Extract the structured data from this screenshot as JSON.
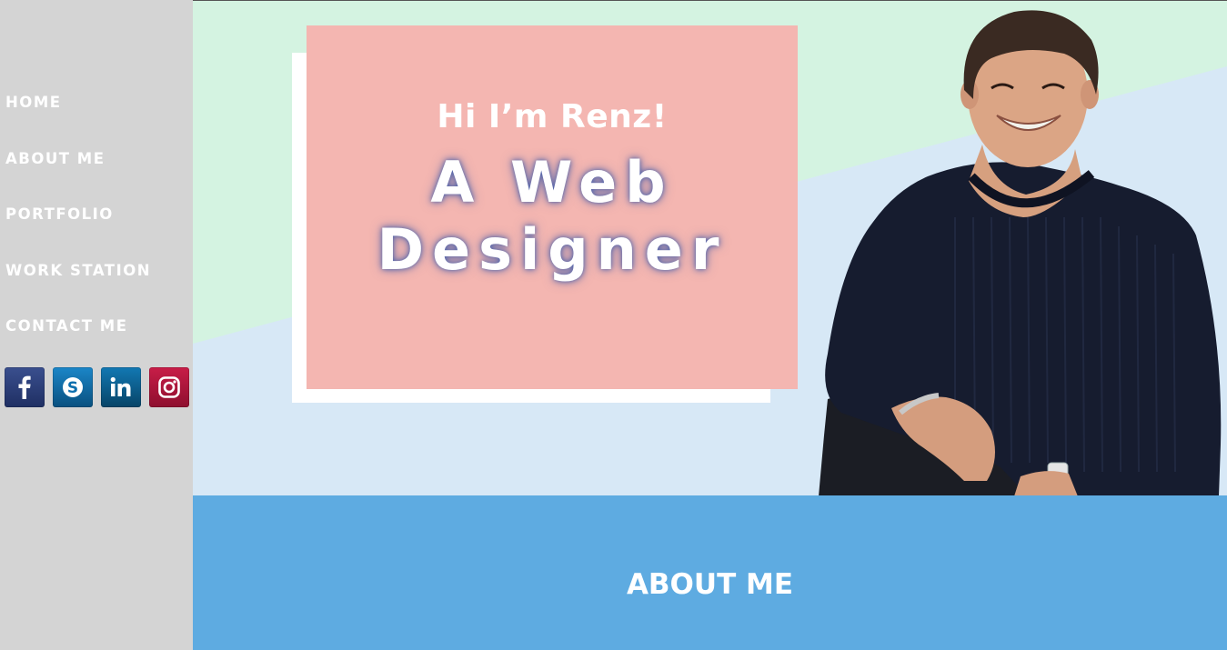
{
  "sidebar": {
    "nav": [
      {
        "label": "HOME"
      },
      {
        "label": "ABOUT ME"
      },
      {
        "label": "PORTFOLIO"
      },
      {
        "label": "WORK STATION"
      },
      {
        "label": "CONTACT ME"
      }
    ],
    "social": [
      {
        "icon": "facebook-icon",
        "glyph": "f",
        "color": "#2b3f7a"
      },
      {
        "icon": "skype-icon",
        "glyph": "S",
        "color": "#0d6fae"
      },
      {
        "icon": "linkedin-icon",
        "glyph": "in",
        "color": "#0b5d8f"
      },
      {
        "icon": "instagram-icon",
        "glyph": "",
        "color": "#b0163b"
      }
    ]
  },
  "hero": {
    "greeting": "Hi I’m Renz!",
    "role_line1": "A Web",
    "role_line2": "Designer"
  },
  "about": {
    "title": "ABOUT ME"
  },
  "colors": {
    "sidebar_bg": "#d4d4d4",
    "hero_mint": "#d4f3e1",
    "hero_blue": "#d7e8f6",
    "card_pink": "#f4b6b1",
    "about_blue": "#5eabe1"
  }
}
